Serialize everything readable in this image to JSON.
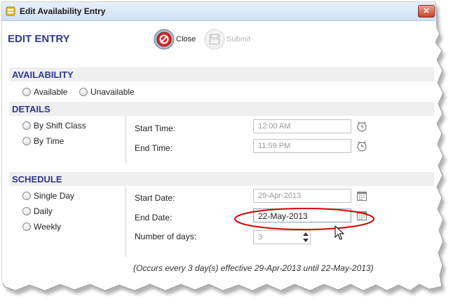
{
  "window": {
    "title": "Edit Availability Entry",
    "close_glyph": "✕"
  },
  "page_title": "EDIT ENTRY",
  "toolbar": {
    "close": {
      "label": "Close",
      "icon": "close-circle-icon"
    },
    "submit": {
      "label": "Submit",
      "icon": "save-disk-icon",
      "enabled": false
    }
  },
  "availability": {
    "header": "AVAILABILITY",
    "options": [
      "Available",
      "Unavailable"
    ]
  },
  "details": {
    "header": "DETAILS",
    "options": [
      "By Shift Class",
      "By Time"
    ],
    "start_time": {
      "label": "Start Time:",
      "value": "12:00 AM",
      "icon": "clock-icon"
    },
    "end_time": {
      "label": "End Time:",
      "value": "11:59 PM",
      "icon": "clock-icon"
    }
  },
  "schedule": {
    "header": "SCHEDULE",
    "options": [
      "Single Day",
      "Daily",
      "Weekly"
    ],
    "start_date": {
      "label": "Start Date:",
      "value": "29-Apr-2013",
      "icon": "calendar-icon"
    },
    "end_date": {
      "label": "End Date:",
      "value": "22-May-2013",
      "icon": "calendar-icon"
    },
    "num_days": {
      "label": "Number of days:",
      "value": "3"
    },
    "summary": "(Occurs every 3 day(s) effective 29-Apr-2013 until 22-May-2013)"
  },
  "colors": {
    "accent": "#2c3a8e",
    "highlight": "#d40000",
    "close_button": "#d42a2a"
  }
}
